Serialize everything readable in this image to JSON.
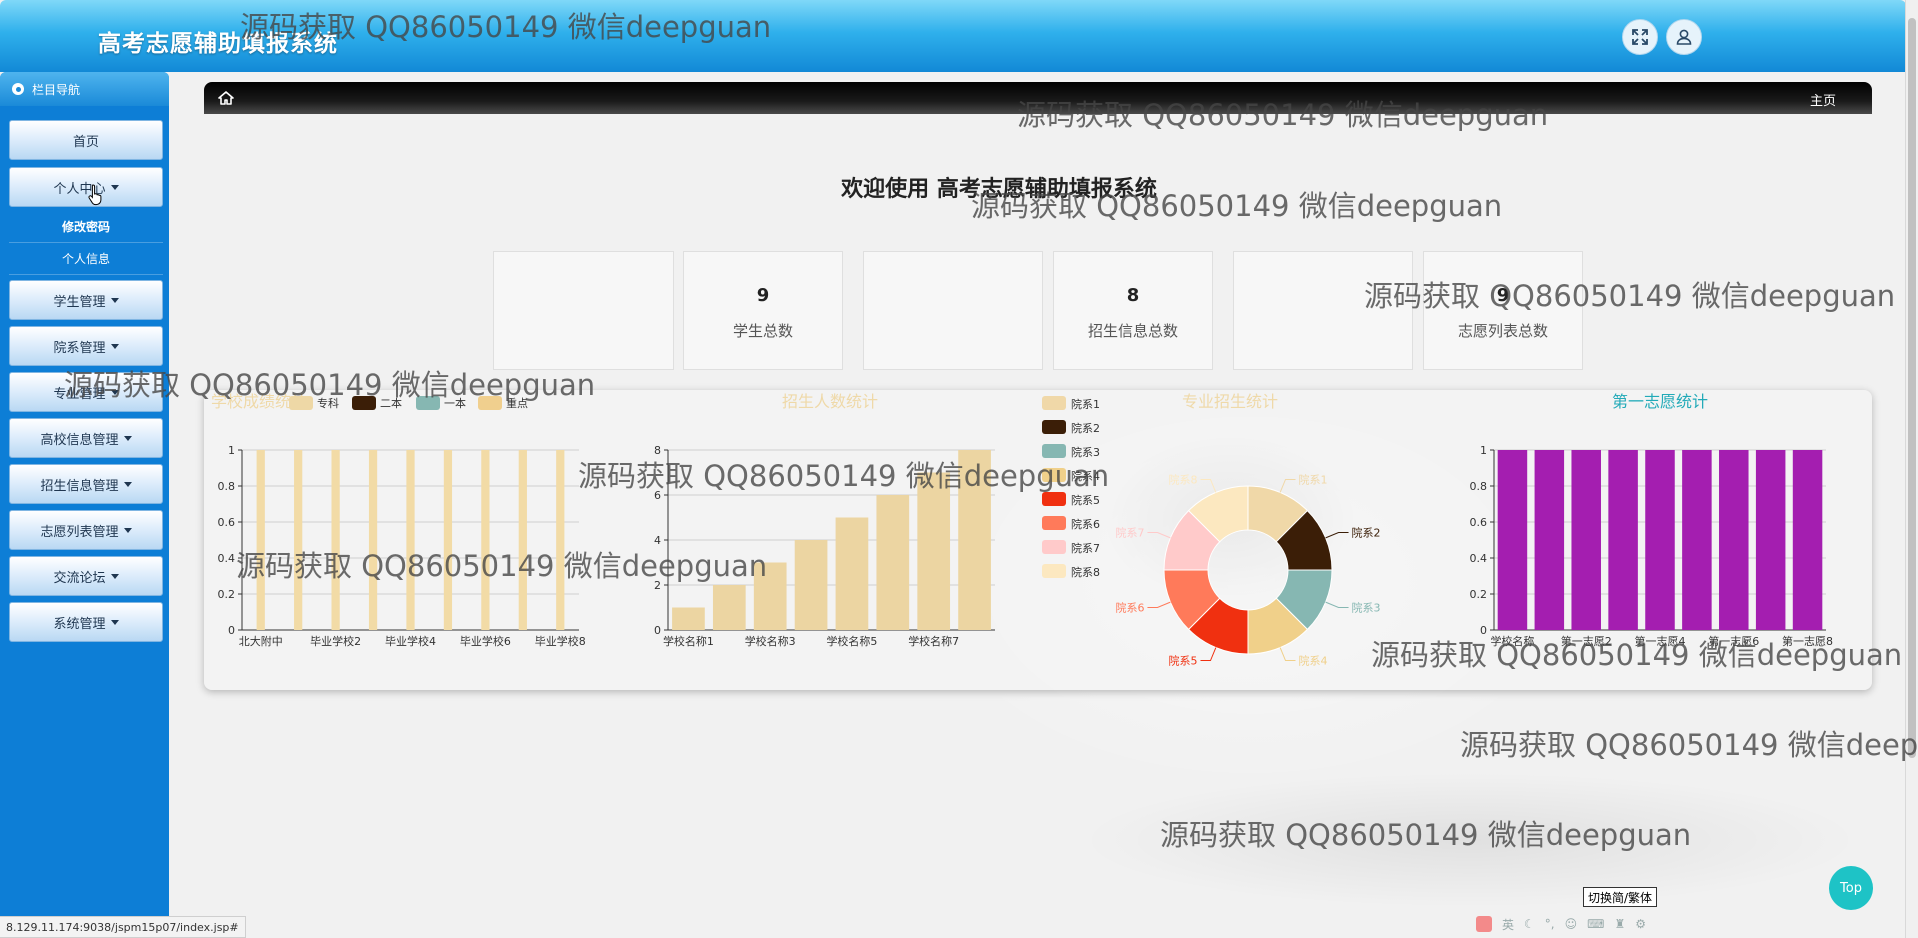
{
  "header": {
    "title": "高考志愿辅助填报系统"
  },
  "sidebar": {
    "title": "栏目导航",
    "home": "首页",
    "personal": {
      "label": "个人中心",
      "subitems": [
        "修改密码",
        "个人信息"
      ]
    },
    "menus": [
      "学生管理",
      "院系管理",
      "专业管理",
      "高校信息管理",
      "招生信息管理",
      "志愿列表管理",
      "交流论坛",
      "系统管理"
    ]
  },
  "breadcrumb": {
    "label": "主页"
  },
  "welcome": "欢迎使用 高考志愿辅助填报系统",
  "stats": [
    {
      "value": "9",
      "label": "学生总数"
    },
    {
      "value": "8",
      "label": "招生信息总数"
    },
    {
      "value": "9",
      "label": "志愿列表总数"
    }
  ],
  "chart_data": [
    {
      "type": "bar",
      "title": "学校成绩统计",
      "legend": [
        "专科",
        "二本",
        "一本",
        "重点"
      ],
      "legend_colors": [
        "#eed8a6",
        "#3b1e07",
        "#86b7b2",
        "#f0cf8e"
      ],
      "categories": [
        "北大附中",
        "毕业学校2",
        "毕业学校4",
        "毕业学校6",
        "毕业学校8"
      ],
      "values": [
        1,
        1,
        1,
        1,
        1,
        1,
        1,
        1,
        1
      ],
      "ylim": [
        0,
        1
      ],
      "yticks": [
        "0",
        "0.2",
        "0.4",
        "0.6",
        "0.8",
        "1"
      ],
      "color": "#f2dba6"
    },
    {
      "type": "bar",
      "title": "招生人数统计",
      "categories": [
        "学校名称1",
        "学校名称3",
        "学校名称5",
        "学校名称7"
      ],
      "values": [
        1,
        2,
        3,
        4,
        5,
        6,
        7,
        8
      ],
      "ylim": [
        0,
        8
      ],
      "yticks": [
        "0",
        "2",
        "4",
        "6",
        "8"
      ],
      "color": "#ecd5a2"
    },
    {
      "type": "pie",
      "title": "专业招生统计",
      "labels": [
        "院系1",
        "院系2",
        "院系3",
        "院系4",
        "院系5",
        "院系6",
        "院系7",
        "院系8"
      ],
      "values": [
        1,
        1,
        1,
        1,
        1,
        1,
        1,
        1
      ],
      "colors": [
        "#f0d8a8",
        "#3b1e07",
        "#86b7b2",
        "#f0d08a",
        "#f03010",
        "#ff7a5a",
        "#ffcaca",
        "#fce8c0"
      ]
    },
    {
      "type": "bar",
      "title": "第一志愿统计",
      "categories": [
        "学校名称",
        "第一志愿2",
        "第一志愿4",
        "第一志愿6",
        "第一志愿8"
      ],
      "values": [
        1,
        1,
        1,
        1,
        1,
        1,
        1,
        1,
        1
      ],
      "ylim": [
        0,
        1
      ],
      "yticks": [
        "0",
        "0.2",
        "0.4",
        "0.6",
        "0.8",
        "1"
      ],
      "color": "#a41eb0"
    }
  ],
  "footer": {
    "url": "8.129.11.174:9038/jspm15p07/index.jsp#",
    "top_button": "Top",
    "lang_switch": "切换简/繁体",
    "ime": "英"
  },
  "watermark": "源码获取 QQ86050149 微信deepguan",
  "theme": {
    "primary": "#0d7ed6",
    "header": "#2fb0ec",
    "accent": "#1ec3c6"
  }
}
